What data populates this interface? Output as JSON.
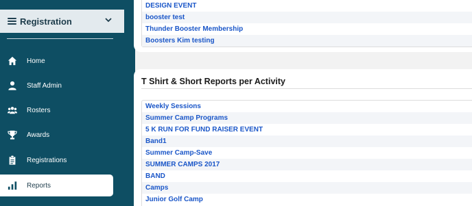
{
  "sidebar": {
    "title": "Registration",
    "items": [
      {
        "label": "Home",
        "icon": "home-icon"
      },
      {
        "label": "Staff Admin",
        "icon": "user-icon"
      },
      {
        "label": "Rosters",
        "icon": "users-icon"
      },
      {
        "label": "Awards",
        "icon": "trophy-icon"
      },
      {
        "label": "Registrations",
        "icon": "clipboard-icon"
      },
      {
        "label": "Reports",
        "icon": "bar-chart-icon",
        "active": true
      }
    ],
    "colors": {
      "background": "#0e4e63",
      "header": "#e3eaee",
      "link": "#1a56c8"
    }
  },
  "top_list": {
    "rows": [
      "DESIGN EVENT",
      "booster test",
      "Thunder Booster Membership",
      "Boosters Kim testing"
    ]
  },
  "section": {
    "title": "T Shirt & Short Reports per Activity",
    "rows": [
      "Weekly Sessions",
      "Summer Camp Programs",
      "5 K RUN FOR FUND RAISER EVENT",
      "Band1",
      "Summer Camp-Save",
      "SUMMER CAMPS 2017",
      "BAND",
      "Camps",
      "Junior Golf Camp"
    ]
  }
}
